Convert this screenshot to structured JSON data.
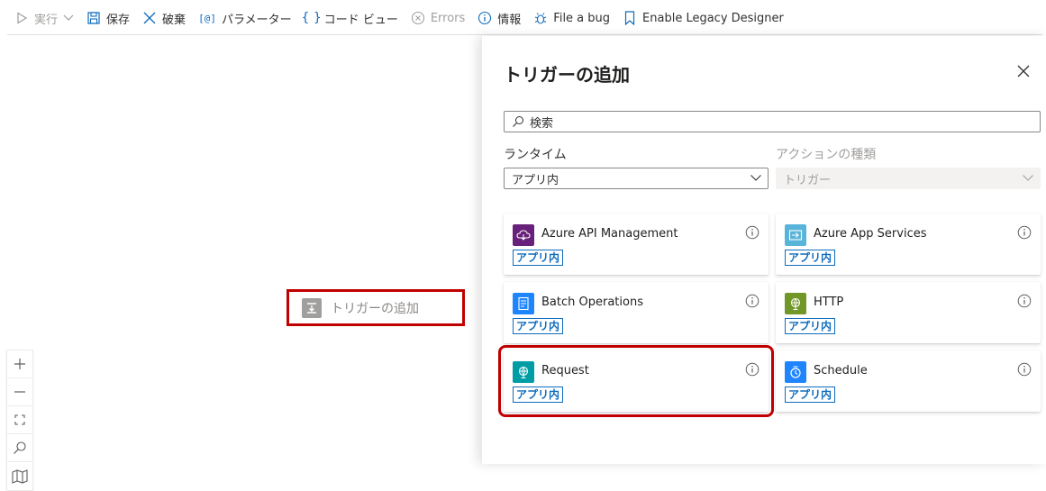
{
  "toolbar": {
    "run": "実行",
    "save": "保存",
    "discard": "破棄",
    "parameters": "パラメーター",
    "code_view": "コード ビュー",
    "errors": "Errors",
    "info": "情報",
    "file_bug": "File a bug",
    "legacy": "Enable Legacy Designer"
  },
  "canvas": {
    "add_trigger": "トリガーの追加"
  },
  "panel": {
    "title": "トリガーの追加",
    "search_placeholder": "検索",
    "runtime_label": "ランタイム",
    "runtime_value": "アプリ内",
    "action_type_label": "アクションの種類",
    "action_type_value": "トリガー",
    "cards": [
      {
        "name": "Azure API Management",
        "badge": "アプリ内",
        "color": "#68217a",
        "icon": "cloud-icon"
      },
      {
        "name": "Azure App Services",
        "badge": "アプリ内",
        "color": "#59b4d9",
        "icon": "app-service-icon"
      },
      {
        "name": "Batch Operations",
        "badge": "アプリ内",
        "color": "#1f85ff",
        "icon": "batch-icon"
      },
      {
        "name": "HTTP",
        "badge": "アプリ内",
        "color": "#709727",
        "icon": "globe-icon"
      },
      {
        "name": "Request",
        "badge": "アプリ内",
        "color": "#009da5",
        "icon": "request-icon"
      },
      {
        "name": "Schedule",
        "badge": "アプリ内",
        "color": "#1f85ff",
        "icon": "clock-icon"
      }
    ]
  },
  "colors": {
    "accent": "#0f6cbd",
    "highlight": "#c00000"
  }
}
